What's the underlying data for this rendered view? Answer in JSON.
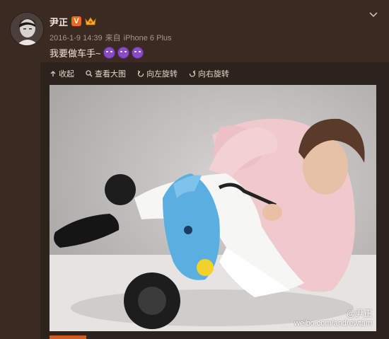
{
  "post": {
    "username": "尹正",
    "verified_mark": "V",
    "time": "2016-1-9 14:39",
    "source_prefix": "来自",
    "source": "iPhone 6 Plus",
    "text": "我要做车手~"
  },
  "toolbar": {
    "collapse": "收起",
    "view_large": "查看大图",
    "rotate_left": "向左旋转",
    "rotate_right": "向右旋转"
  },
  "photo": {
    "watermark_name": "@尹正",
    "watermark_url": "weibo.com/andrewtam"
  },
  "colors": {
    "background": "#3a2a22",
    "verified_badge": "#e86a1a",
    "emoji": "#8a4bc4"
  }
}
